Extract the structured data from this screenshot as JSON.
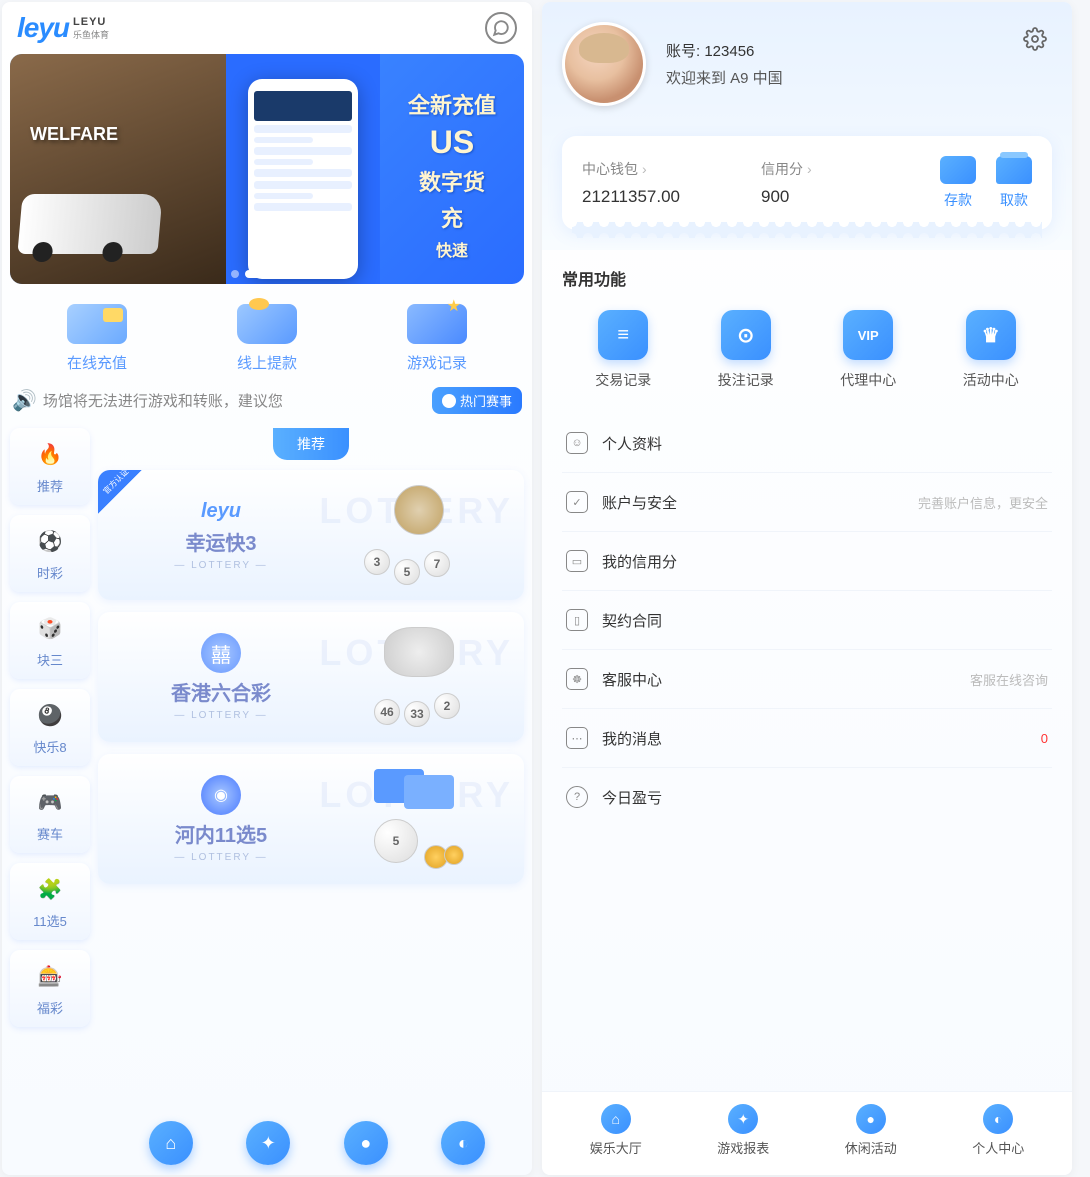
{
  "logo": {
    "main": "leyu",
    "sub_top": "LEYU",
    "sub_bot": "乐鱼体育"
  },
  "banner": {
    "right_lines": [
      "全新充值",
      "US",
      "数字货",
      "充",
      "快速"
    ]
  },
  "quick_actions": [
    {
      "label": "在线充值"
    },
    {
      "label": "线上提款"
    },
    {
      "label": "游戏记录"
    }
  ],
  "marquee": {
    "text": "场馆将无法进行游戏和转账，建议您",
    "hot": "热门赛事"
  },
  "recommend_tag": "推荐",
  "sidebar_tabs": [
    {
      "label": "推荐",
      "icon": "🔥"
    },
    {
      "label": "时彩",
      "icon": "⚽"
    },
    {
      "label": "块三",
      "icon": "🎲"
    },
    {
      "label": "快乐8",
      "icon": "🎱"
    },
    {
      "label": "赛车",
      "icon": "🎮"
    },
    {
      "label": "11选5",
      "icon": "🧩"
    },
    {
      "label": "福彩",
      "icon": "🎰"
    }
  ],
  "games": [
    {
      "logo": "leyu",
      "title": "幸运快3",
      "sub": "— LOTTERY —",
      "badge": "官方认证"
    },
    {
      "logo": "",
      "title": "香港六合彩",
      "sub": "— LOTTERY —"
    },
    {
      "logo": "",
      "title": "河内11选5",
      "sub": "— LOTTERY —"
    }
  ],
  "profile": {
    "account_label": "账号:",
    "account": "123456",
    "welcome": "欢迎来到 A9 中国"
  },
  "wallet": {
    "center_label": "中心钱包",
    "center_value": "21211357.00",
    "credit_label": "信用分",
    "credit_value": "900",
    "deposit": "存款",
    "withdraw": "取款"
  },
  "common_func_title": "常用功能",
  "common_funcs": [
    {
      "label": "交易记录",
      "icon": "≡"
    },
    {
      "label": "投注记录",
      "icon": "⊙"
    },
    {
      "label": "代理中心",
      "icon": "VIP"
    },
    {
      "label": "活动中心",
      "icon": "♛"
    }
  ],
  "menu": [
    {
      "label": "个人资料",
      "icon": "☺",
      "hint": ""
    },
    {
      "label": "账户与安全",
      "icon": "✓",
      "hint": "完善账户信息，更安全"
    },
    {
      "label": "我的信用分",
      "icon": "▭",
      "hint": ""
    },
    {
      "label": "契约合同",
      "icon": "▯",
      "hint": ""
    },
    {
      "label": "客服中心",
      "icon": "☸",
      "hint": "客服在线咨询"
    },
    {
      "label": "我的消息",
      "icon": "⋯",
      "hint": "0",
      "hint_red": true
    },
    {
      "label": "今日盈亏",
      "icon": "?",
      "hint": "",
      "round": true
    }
  ],
  "bottom_nav": [
    {
      "label": "娱乐大厅",
      "icon": "⌂"
    },
    {
      "label": "游戏报表",
      "icon": "✦"
    },
    {
      "label": "休闲活动",
      "icon": "●"
    },
    {
      "label": "个人中心",
      "icon": "◐"
    }
  ]
}
